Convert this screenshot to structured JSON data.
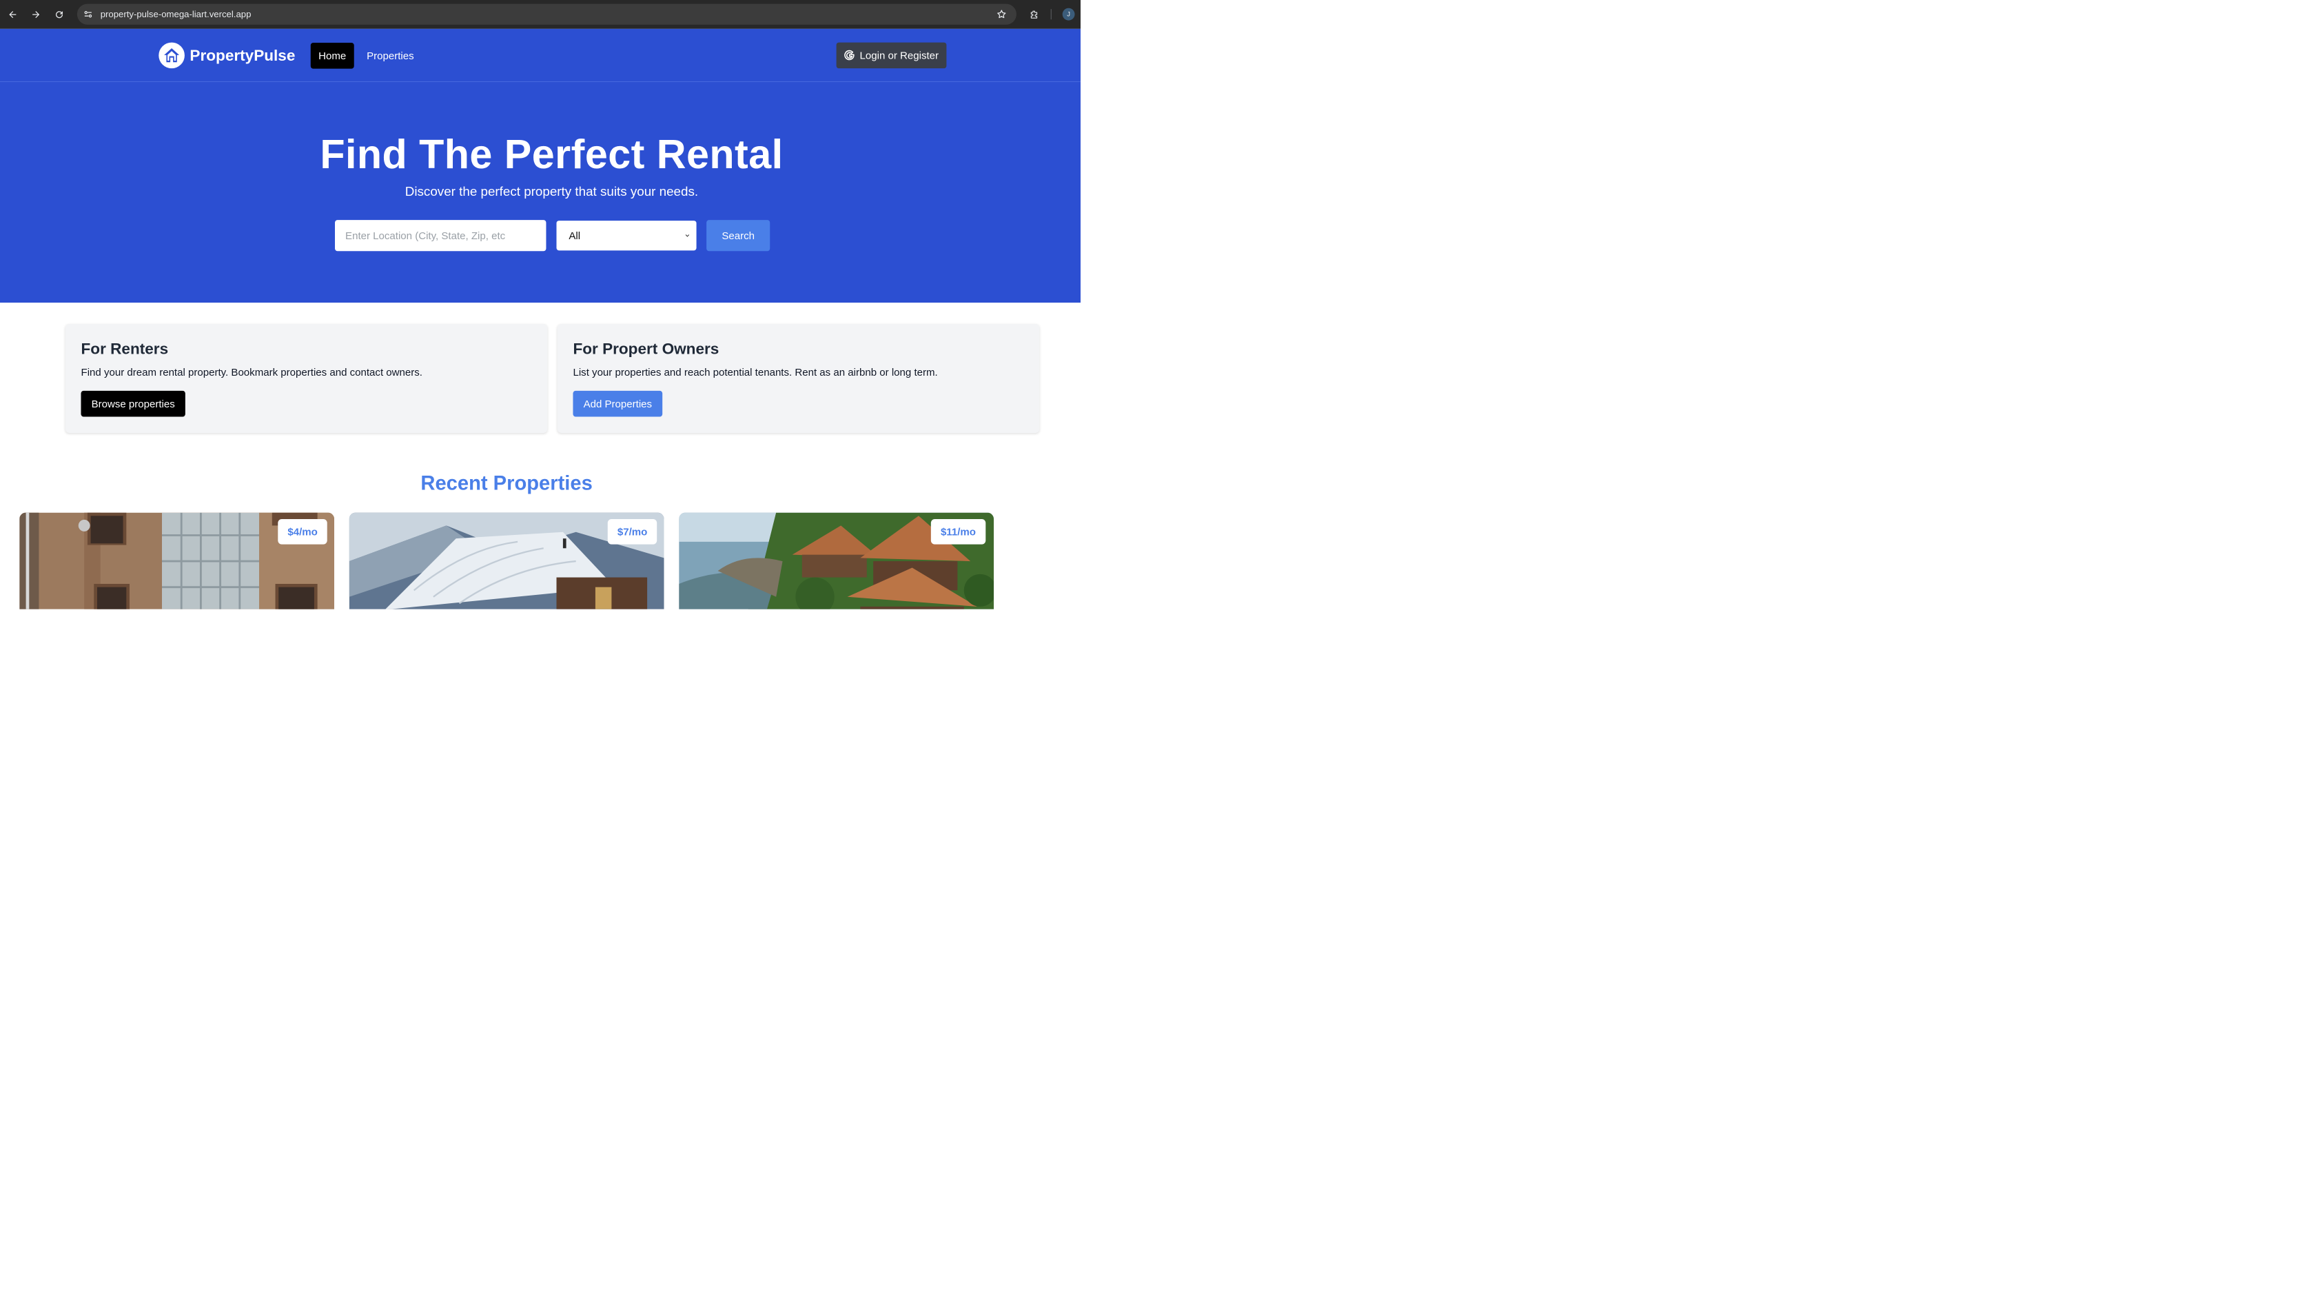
{
  "browser": {
    "url": "property-pulse-omega-liart.vercel.app",
    "profile_initial": "J"
  },
  "nav": {
    "brand": "PropertyPulse",
    "links": [
      "Home",
      "Properties"
    ],
    "active": "Home",
    "login_label": "Login or Register"
  },
  "hero": {
    "title": "Find The Perfect Rental",
    "subtitle": "Discover the perfect property that suits your needs.",
    "search_placeholder": "Enter Location (City, State, Zip, etc",
    "type_selected": "All",
    "search_label": "Search"
  },
  "info_cards": [
    {
      "title": "For Renters",
      "text": "Find your dream rental property. Bookmark properties and contact owners.",
      "button": "Browse properties"
    },
    {
      "title": "For Propert Owners",
      "text": "List your properties and reach potential tenants. Rent as an airbnb or long term.",
      "button": "Add Properties"
    }
  ],
  "recent": {
    "title": "Recent Properties",
    "properties": [
      {
        "price": "$4/mo"
      },
      {
        "price": "$7/mo"
      },
      {
        "price": "$11/mo"
      }
    ]
  },
  "colors": {
    "brand_blue": "#2c4fd2",
    "accent_blue": "#4a7fe8",
    "black_button": "#000000",
    "card_bg": "#f3f4f6"
  },
  "icons": {
    "back": "back-arrow-icon",
    "forward": "forward-arrow-icon",
    "reload": "reload-icon",
    "site_settings": "site-settings-icon",
    "bookmark": "star-icon",
    "extensions": "puzzle-icon",
    "logo": "home-icon",
    "login": "google-g-icon",
    "select": "chevron-down-icon"
  }
}
